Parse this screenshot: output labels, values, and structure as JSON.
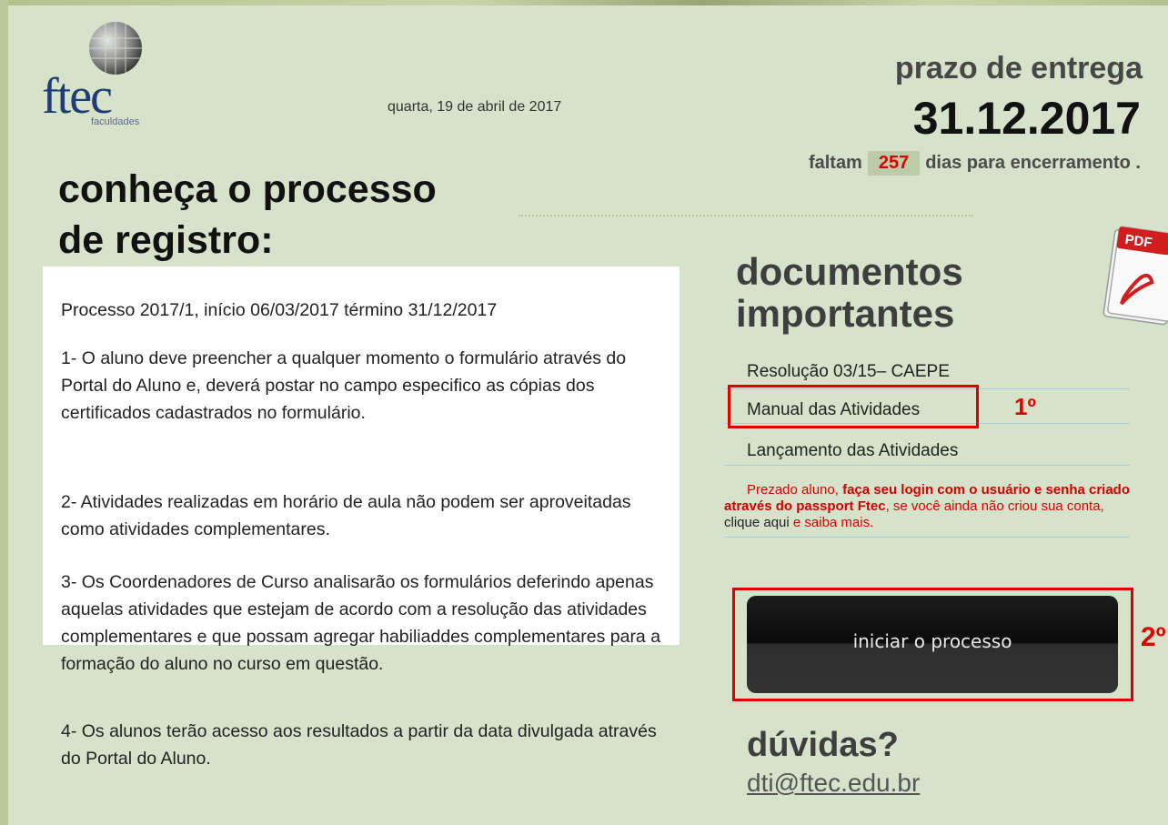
{
  "header": {
    "logo_text": "ftec",
    "logo_sub": "faculdades",
    "date": "quarta, 19 de abril de 2017",
    "deadline_label": "prazo de entrega",
    "deadline_date": "31.12.2017",
    "countdown": {
      "prefix": "faltam",
      "days": "257",
      "suffix": "dias para encerramento ."
    }
  },
  "process": {
    "title_line1": "conheça o processo",
    "title_line2": "de registro:",
    "paragraphs": [
      "Processo 2017/1, início 06/03/2017 término 31/12/2017",
      "1- O aluno deve preencher a qualquer momento o formulário através do Portal do Aluno e, deverá postar no campo especifico as cópias dos certificados cadastrados no formulário.",
      "2- Atividades realizadas em horário de aula não podem ser aproveitadas como atividades complementares.",
      "3- Os Coordenadores de Curso analisarão os formulários deferindo apenas aquelas atividades que estejam de acordo com a resolução das atividades complementares e que possam agregar habiliaddes complementares para a formação do aluno no curso em questão.",
      "4- Os alunos terão acesso aos resultados a partir da data divulgada através do Portal do Aluno."
    ]
  },
  "documents": {
    "title_line1": "documentos",
    "title_line2": "importantes",
    "pdf_icon_label": "PDF",
    "links": [
      "Resolução 03/15– CAEPE",
      "Manual das Atividades",
      "Lançamento das Atividades"
    ],
    "marker_1": "1º",
    "notice": {
      "part1": "Prezado aluno, ",
      "bold": "faça seu login com o usuário e senha criado através do passport Ftec",
      "part2": ", se você ainda não criou sua conta, ",
      "link": "clique aqui",
      "part3": " e saiba mais."
    }
  },
  "start": {
    "button_label": "iniciar o processo",
    "marker_2": "2º"
  },
  "faq": {
    "title": "dúvidas?",
    "email": "dti@ftec.edu.br"
  }
}
